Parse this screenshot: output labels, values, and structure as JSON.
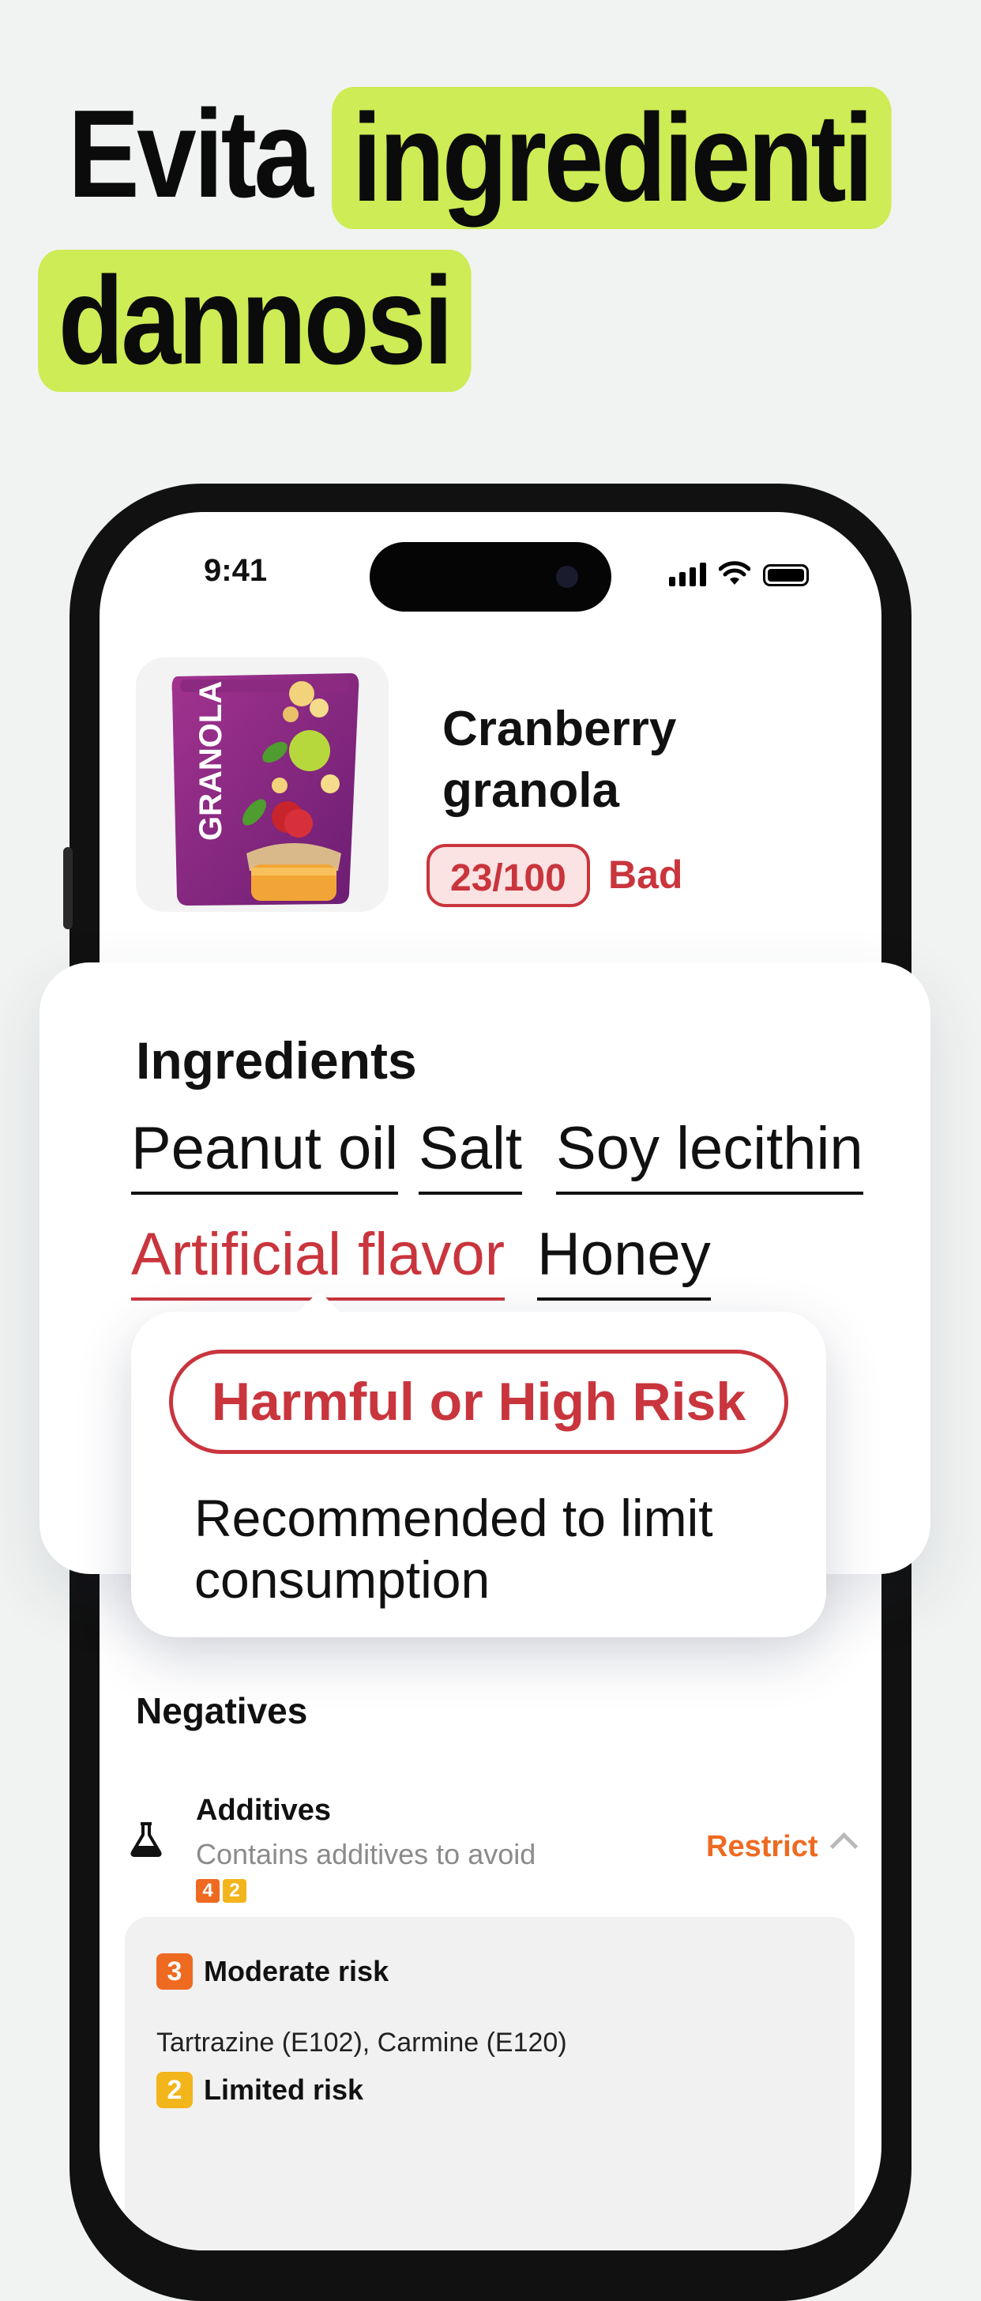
{
  "headline": {
    "plain": "Evita",
    "highlight1": "ingredienti",
    "highlight2": "dannosi",
    "highlight_color": "#cdec55"
  },
  "status_bar": {
    "time": "9:41",
    "icons": [
      "cellular-signal-icon",
      "wifi-icon",
      "battery-icon"
    ]
  },
  "product": {
    "title_line1": "Cranberry",
    "title_line2": "granola",
    "score": "23/100",
    "rating": "Bad",
    "rating_color": "#c9353d",
    "package_text": "GRANOLA"
  },
  "ingredients": {
    "title": "Ingredients",
    "items": [
      "Peanut oil",
      "Salt",
      "Soy lecithin",
      "Artificial flavor",
      "Honey"
    ]
  },
  "popup": {
    "risk_level": "Harmful or High Risk",
    "description": "Recommended to limit consumption"
  },
  "negatives": {
    "title": "Negatives",
    "additives": {
      "title": "Additives",
      "subtitle": "Contains additives to avoid",
      "badges": [
        "4",
        "2"
      ],
      "action": "Restrict"
    },
    "risks": [
      {
        "badge": "3",
        "label": "Moderate risk",
        "items": "Tartrazine (E102), Carmine (E120)",
        "color": "#ee6a21"
      },
      {
        "badge": "2",
        "label": "Limited risk",
        "color": "#f3b51c"
      }
    ]
  }
}
